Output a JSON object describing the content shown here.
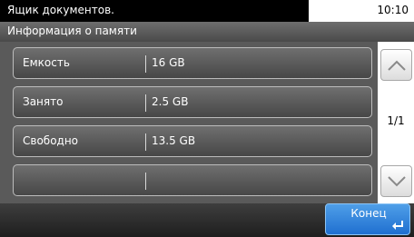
{
  "status_bar": {
    "title": "Ящик документов.",
    "time": "10:10"
  },
  "header": {
    "title": "Информация о памяти"
  },
  "memory_info": {
    "rows": [
      {
        "label": "Емкость",
        "value": "16 GB"
      },
      {
        "label": "Занято",
        "value": "2.5 GB"
      },
      {
        "label": "Свободно",
        "value": "13.5 GB"
      },
      {
        "label": "",
        "value": ""
      }
    ]
  },
  "pagination": {
    "page_label": "1/1"
  },
  "footer": {
    "end_button_label": "Конец"
  },
  "colors": {
    "accent": "#2a7fdc",
    "row_background": "#5a5a5a"
  },
  "icons": {
    "scroll_up": "chevron-up-icon",
    "scroll_down": "chevron-down-icon",
    "enter": "enter-arrow-icon"
  }
}
